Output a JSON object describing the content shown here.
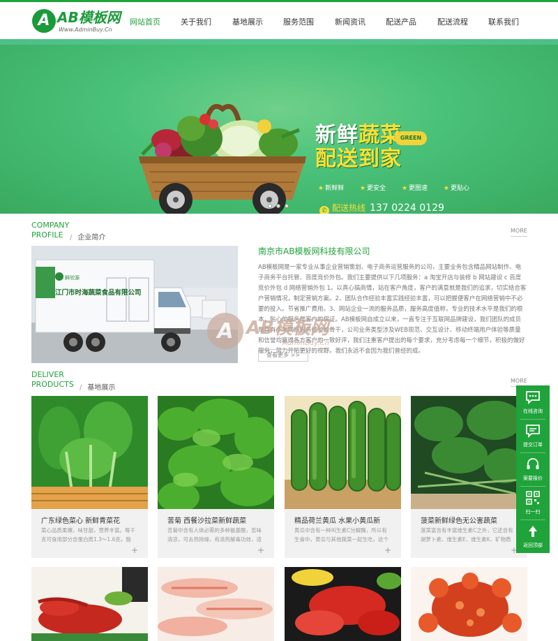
{
  "brand": {
    "logo_letter": "A",
    "logo_text": "AB模板网",
    "logo_sub": "Www.AdminBuy.Cn",
    "accent_color": "#1fa33a"
  },
  "nav": {
    "items": [
      "网站首页",
      "关于我们",
      "基地展示",
      "服务范围",
      "新闻资讯",
      "配送产品",
      "配送流程",
      "联系我们"
    ],
    "active_index": 0
  },
  "banner": {
    "slogan_line1_a": "新鲜",
    "slogan_line1_b": "蔬菜",
    "slogan_line2": "配送到家",
    "badge": "GREEN",
    "features": [
      "新鲜鲜",
      "更安全",
      "更图速",
      "更贴心"
    ],
    "hotline_label": "配送热线",
    "hotline_number": "137 0224 0129",
    "slide_count": 3,
    "active_slide": 0
  },
  "about": {
    "title_en_1": "COMPANY",
    "title_en_2": "PROFILE",
    "title_cn": "企业简介",
    "more": "MORE",
    "company_name": "南京市AB模板网科技有限公司",
    "text": "AB模板网是一家专业从事企业营销策划、电子商务运营服务的公司，主要业务包含精品网站制作、电子商务平台托管、百度竞价外包。我们主要提供以下几项服务：a 淘宝开店与装修 b 网站建设 c 百度竞价外包 d 网络营销外包 1。以真心搞商情，站在客户角度，客户的满意就是我们的追求，切实结合客户营销情况，制定营销方案。2、团队合作经验丰富实践经验丰富，可以把握便客户在网络营销中不必要的投入。节省推广费用。3、网站企业一流的服务品质，服务高度值称，专业的技术水平是我们的根本，贴心的服务是客户的保证。AB模板网自成立以来，一直专注于互联网品牌建设，我们团队的成员是具有多年网络服务经验的骨干，公司业务类型涉及WEB现范、交互设计、移动终端用户体验等质量和信誉均赢得各方客户的一致好评，我们注重客户提出的每个要求，充分考虑每一个细节，积极的做好服务，努力开拓更好的视野。我们永远不会因为我们曾经的成。",
    "more_button": "查看更多 >>",
    "watermark_main": "AB模板网",
    "watermark_sub": "AdminBuy.Cn",
    "truck_sign": "江门市时海蔬菜食品有限公司"
  },
  "products": {
    "title_en_1": "DELIVER",
    "title_en_2": "PRODUCTS",
    "title_cn": "基地展示",
    "more": "MORE",
    "items": [
      {
        "title": "广东绿色菜心 新鲜青菜花",
        "desc": "菜心品质柔嫩，味甘甜，营养丰富。每千克可食用部分含蛋白质1.3～1.6克，脂肪..."
      },
      {
        "title": "苦菊 西餐沙拉菜新鲜蔬菜",
        "desc": "苦菊中含有人体必需的多种氨基酸，苦味清凉，可去热除燥，有清热解毒功效，适合炎热季节..."
      },
      {
        "title": "精品荷兰黄瓜 水果小黄瓜新",
        "desc": "黄瓜中含有一种叫生素C分解酶，所以有生食中，黄瓜与其他蔬菜一起生吃，这个酶能..."
      },
      {
        "title": "菠菜新鲜绿色无公害蔬菜",
        "desc": "菠菜富含有丰富维生素C之外，它还含有胡萝卜素、维生素E、维生素K、矿物质（钙质、铁质..."
      }
    ],
    "plus": "+"
  },
  "sidebar": {
    "items": [
      "在线咨询",
      "提交订单",
      "案要报价",
      "扫一扫",
      "返回顶部"
    ]
  }
}
